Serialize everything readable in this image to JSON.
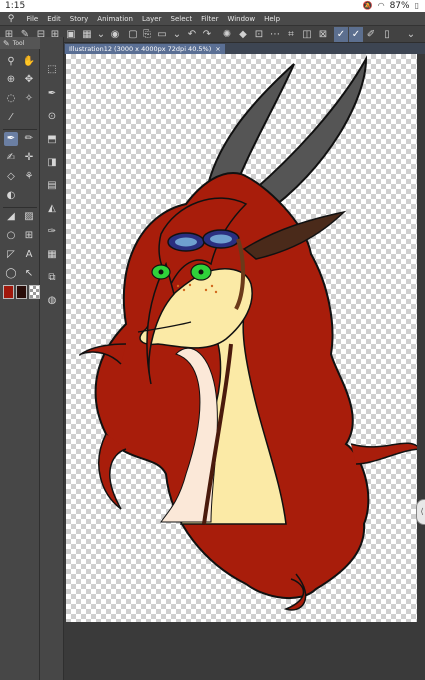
{
  "status": {
    "time": "1:15",
    "battery": "87%"
  },
  "menu": {
    "app_icon": "clip-studio-icon",
    "items": [
      "File",
      "Edit",
      "Story",
      "Animation",
      "Layer",
      "Select",
      "Filter",
      "Window",
      "Help"
    ]
  },
  "tool_panel": {
    "header_label": "Tool"
  },
  "canvas": {
    "tab_title": "Illustration12 (3000 x 4000px 72dpi 40.5%)",
    "close_glyph": "×"
  },
  "colors": {
    "main": "#a0180c",
    "sub": "#2a0e0a",
    "hair": "#a81d0b",
    "skin": "#fbeaa6",
    "horn": "#555555",
    "accent": "#5c6f8f"
  }
}
